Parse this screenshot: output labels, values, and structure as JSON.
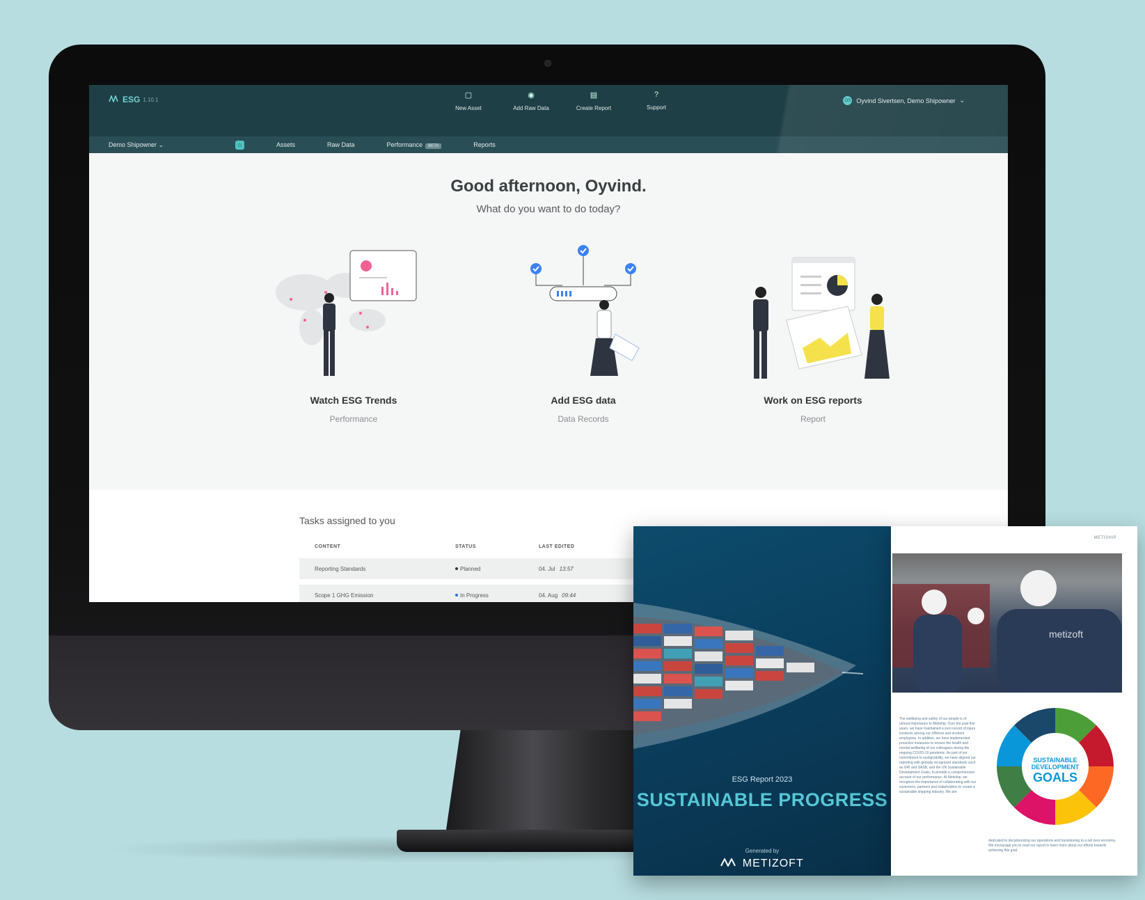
{
  "app": {
    "logo_text": "ESG",
    "version": "1.10.1",
    "user_initials": "OS",
    "user_name": "Oyvind Sivertsen, Demo Shipowner"
  },
  "actions": [
    {
      "label": "New Asset"
    },
    {
      "label": "Add Raw Data"
    },
    {
      "label": "Create Report"
    },
    {
      "label": "Support"
    }
  ],
  "nav": {
    "company": "Demo Shipowner",
    "items": [
      "Assets",
      "Raw Data",
      "Performance",
      "Reports"
    ],
    "beta": "BETA"
  },
  "greeting": {
    "title": "Good afternoon, Oyvind.",
    "subtitle": "What do you want to do today?"
  },
  "cards": [
    {
      "title": "Watch ESG Trends",
      "sub": "Performance"
    },
    {
      "title": "Add ESG data",
      "sub": "Data Records"
    },
    {
      "title": "Work on ESG reports",
      "sub": "Report"
    }
  ],
  "tasks": {
    "title": "Tasks assigned to you",
    "headers": [
      "CONTENT",
      "STATUS",
      "LAST EDITED"
    ],
    "rows": [
      {
        "content": "Reporting Standards",
        "status": "Planned",
        "date": "04. Jul",
        "time": "13:57"
      },
      {
        "content": "Scope 1 GHG Emission",
        "status": "In Progress",
        "date": "04. Aug",
        "time": "09:44"
      }
    ]
  },
  "brochure": {
    "report_year": "ESG Report 2023",
    "title": "SUSTAINABLE PROGRESS",
    "generated_by": "Generated by",
    "brand": "METIZOFT",
    "page_header": "METISHIP",
    "photo_label": "metizoft",
    "sdg_line1": "SUSTAINABLE",
    "sdg_line2": "DEVELOPMENT",
    "sdg_line3": "GOALS",
    "body_text": "The wellbeing and safety of our people is of utmost importance to Metiship. Over the past five years, we have maintained a zero record of injury incidents among our offshore and onshore employees. In addition, we have implemented proactive measures to ensure the health and mental wellbeing of our colleagues during the ongoing COVID-19 pandemic. As part of our commitment to sustainability, we have aligned our reporting with globally recognized standards such as GRI and SASB, and the UN Sustainable Development Goals, to provide a comprehensive account of our performance. At Metiship, we recognize the importance of collaborating with our customers, partners and stakeholders to create a sustainable shipping industry. We are",
    "foot_text": "dedicated to decarbonizing our operations and transitioning to a net zero economy. We encourage you to read our report to learn more about our efforts towards achieving this goal."
  }
}
